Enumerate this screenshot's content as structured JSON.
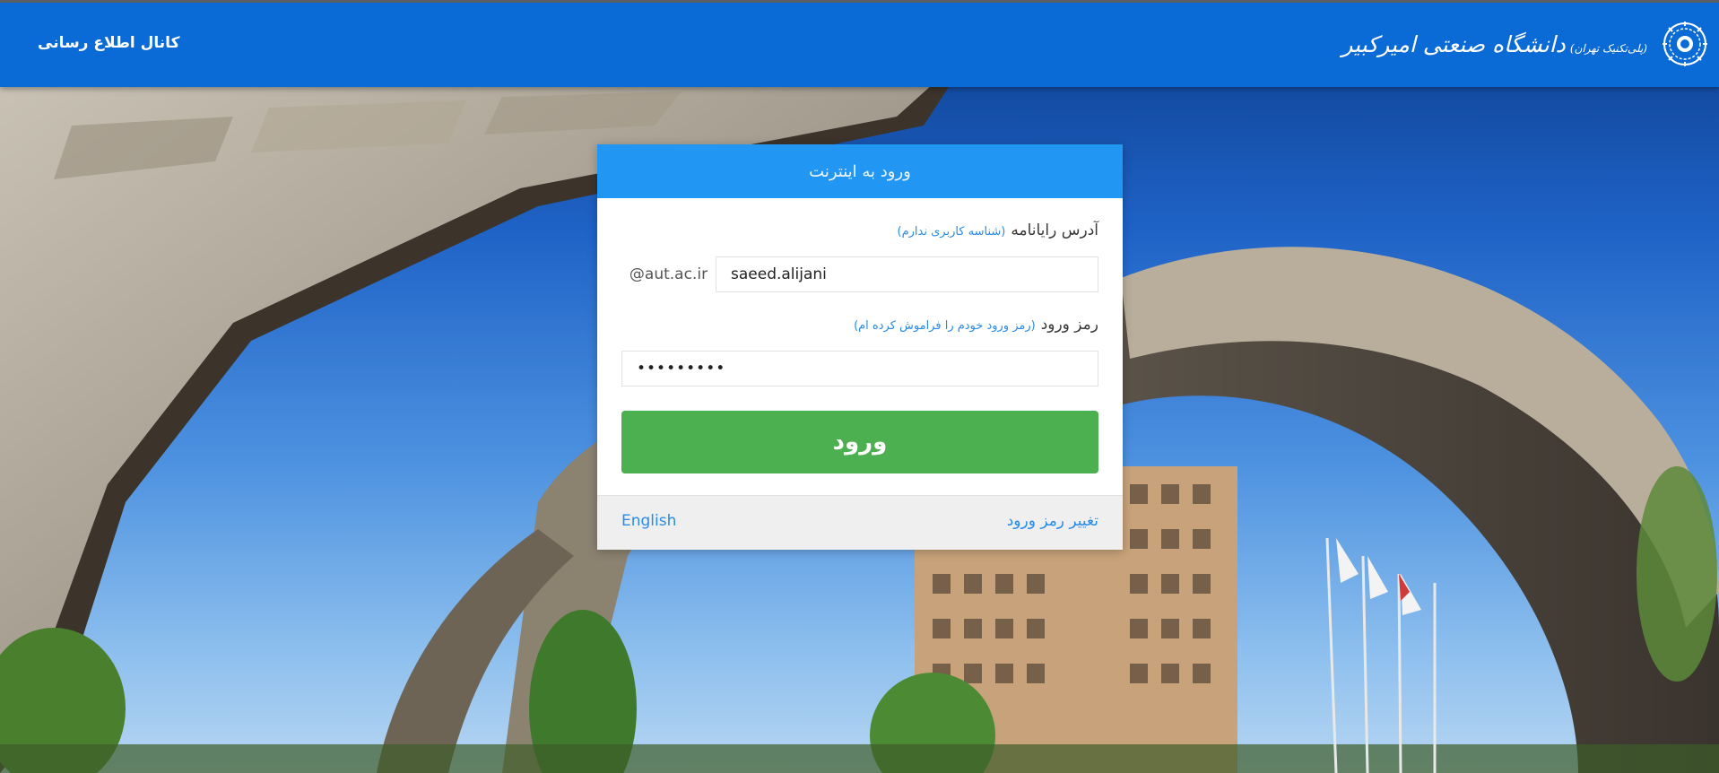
{
  "topbar": {
    "channel_link": "کانال اطلاع رسانی",
    "brand_name": "دانشگاه صنعتی امیرکبیر",
    "brand_sub": "(پلی‌تکنیک تهران)",
    "logo_icon": "university-seal-icon"
  },
  "login": {
    "title": "ورود به اینترنت",
    "email_label": "آدرس رایانامه",
    "email_hint": "(شناسه کاربری ندارم)",
    "email_value": "saeed.alijani",
    "email_domain": "@aut.ac.ir",
    "password_label": "رمز ورود",
    "password_hint": "(رمز ورود خودم را فراموش کرده ام)",
    "password_value": "•••••••••",
    "submit_label": "ورود",
    "change_password_link": "تغییر رمز ورود",
    "language_link": "English"
  },
  "colors": {
    "topbar": "#0a6ad6",
    "card_header": "#2196f3",
    "submit": "#4caf50",
    "link": "#2b8be6",
    "footer": "#efefef"
  }
}
